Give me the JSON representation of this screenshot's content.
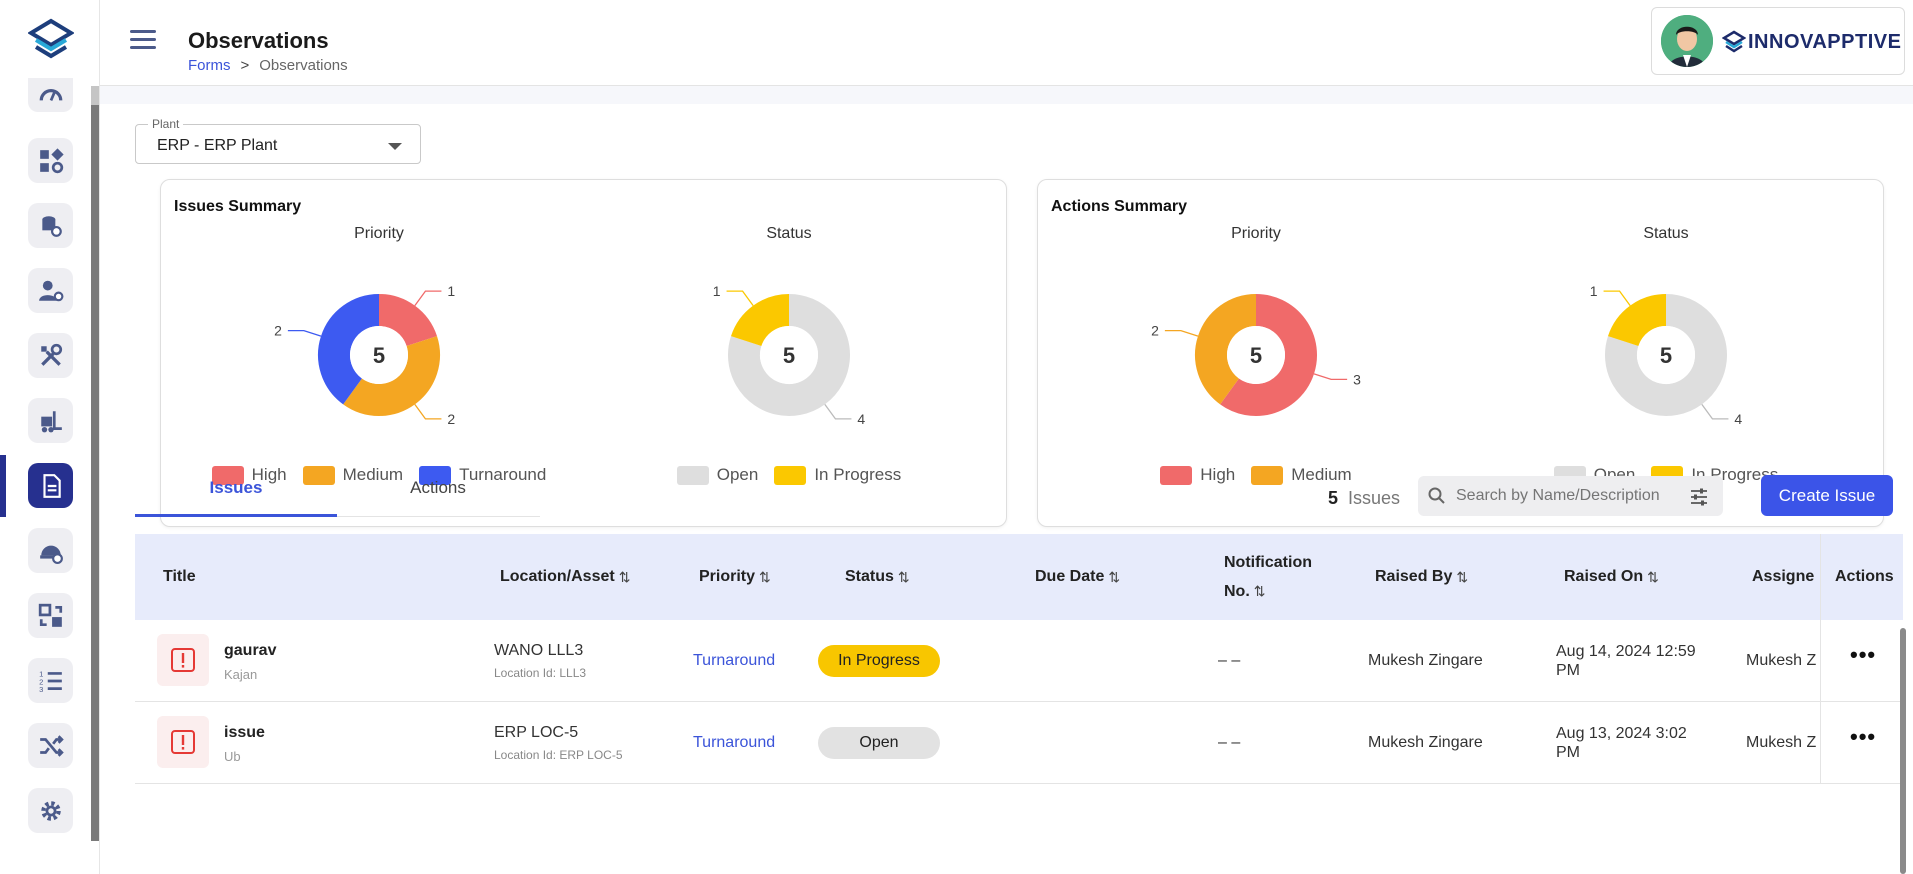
{
  "header": {
    "title": "Observations",
    "breadcrumb": {
      "link": "Forms",
      "separator": ">",
      "current": "Observations"
    },
    "brand": "INNOVAPPTIVE"
  },
  "plant": {
    "label": "Plant",
    "value": "ERP - ERP Plant"
  },
  "chart_data": [
    {
      "card": "Issues Summary",
      "title": "Priority",
      "type": "pie",
      "center": "5",
      "labels": [
        "High",
        "Medium",
        "Turnaround"
      ],
      "values": [
        1,
        2,
        2
      ],
      "colors": [
        "#f06a6a",
        "#f4a622",
        "#3d5af1"
      ]
    },
    {
      "card": "Issues Summary",
      "title": "Status",
      "type": "pie",
      "center": "5",
      "labels": [
        "Open",
        "In Progress"
      ],
      "values": [
        4,
        1
      ],
      "colors": [
        "#dedede",
        "#fbc800"
      ]
    },
    {
      "card": "Actions Summary",
      "title": "Priority",
      "type": "pie",
      "center": "5",
      "labels": [
        "High",
        "Medium"
      ],
      "values": [
        3,
        2
      ],
      "colors": [
        "#f06a6a",
        "#f4a622"
      ]
    },
    {
      "card": "Actions Summary",
      "title": "Status",
      "type": "pie",
      "center": "5",
      "labels": [
        "Open",
        "In Progress"
      ],
      "values": [
        4,
        1
      ],
      "colors": [
        "#dedede",
        "#fbc800"
      ]
    }
  ],
  "summaries": {
    "issues_title": "Issues Summary",
    "actions_title": "Actions Summary"
  },
  "tabs": [
    {
      "label": "Issues",
      "active": true
    },
    {
      "label": "Actions",
      "active": false
    }
  ],
  "toolbar": {
    "count": "5",
    "count_label": "Issues",
    "search_placeholder": "Search by Name/Description",
    "create_label": "Create Issue"
  },
  "table": {
    "headers": {
      "title": "Title",
      "location": "Location/Asset",
      "priority": "Priority",
      "status": "Status",
      "due_date": "Due Date",
      "notification": "Notification",
      "notification2": "No.",
      "raised_by": "Raised By",
      "raised_on": "Raised On",
      "assignee": "Assigne",
      "actions": "Actions"
    },
    "rows": [
      {
        "title": "gaurav",
        "subtitle": "Kajan",
        "location": "WANO LLL3",
        "location_id": "Location Id: LLL3",
        "priority": "Turnaround",
        "status": "In Progress",
        "due_date": "",
        "notification": "– –",
        "raised_by": "Mukesh Zingare",
        "raised_on_1": "Aug 14, 2024 12:59",
        "raised_on_2": "PM",
        "assignee": "Mukesh Z"
      },
      {
        "title": "issue",
        "subtitle": "Ub",
        "location": "ERP LOC-5",
        "location_id": "Location Id: ERP LOC-5",
        "priority": "Turnaround",
        "status": "Open",
        "due_date": "",
        "notification": "– –",
        "raised_by": "Mukesh Zingare",
        "raised_on_1": "Aug 13, 2024 3:02",
        "raised_on_2": "PM",
        "assignee": "Mukesh Z"
      }
    ]
  },
  "icons": {
    "nav": [
      "gauge-icon",
      "dashboard-settings-icon",
      "database-settings-icon",
      "user-settings-icon",
      "tools-icon",
      "forklift-icon",
      "document-icon",
      "safety-helmet-icon",
      "sync-icon",
      "numbered-list-icon",
      "shuffle-icon",
      "gear-icon"
    ]
  }
}
